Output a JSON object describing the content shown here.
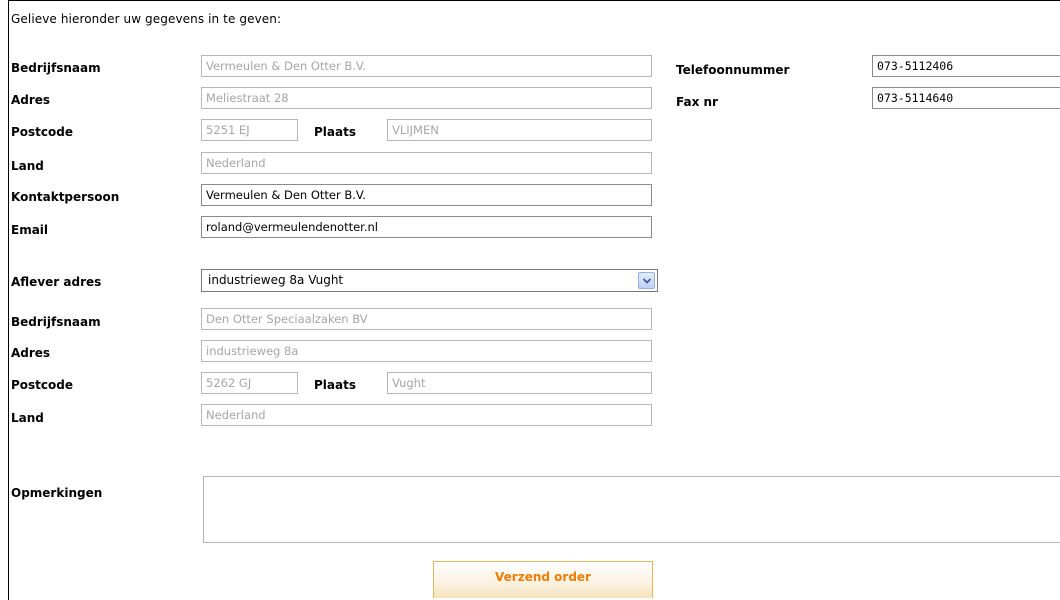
{
  "intro": "Gelieve hieronder uw gegevens in te geven:",
  "company": {
    "bedrijfsnaam_label": "Bedrijfsnaam",
    "bedrijfsnaam_value": "Vermeulen & Den Otter B.V.",
    "adres_label": "Adres",
    "adres_value": "Meliestraat 28",
    "postcode_label": "Postcode",
    "postcode_value": "5251 EJ",
    "plaats_label": "Plaats",
    "plaats_value": "VLIJMEN",
    "land_label": "Land",
    "land_value": "Nederland",
    "kontakt_label": "Kontaktpersoon",
    "kontakt_value": "Vermeulen & Den Otter B.V.",
    "email_label": "Email",
    "email_value": "roland@vermeulendenotter.nl",
    "telefoon_label": "Telefoonnummer",
    "telefoon_value": "073-5112406",
    "fax_label": "Fax nr",
    "fax_value": "073-5114640"
  },
  "delivery": {
    "aflever_label": "Aflever adres",
    "aflever_selected": "industrieweg 8a Vught",
    "bedrijfsnaam_label": "Bedrijfsnaam",
    "bedrijfsnaam_value": "Den Otter Speciaalzaken BV",
    "adres_label": "Adres",
    "adres_value": "industrieweg 8a",
    "postcode_label": "Postcode",
    "postcode_value": "5262 GJ",
    "plaats_label": "Plaats",
    "plaats_value": "Vught",
    "land_label": "Land",
    "land_value": "Nederland"
  },
  "opmerkingen": {
    "label": "Opmerkingen",
    "value": ""
  },
  "submit_label": "Verzend order",
  "icons": {
    "select_arrow": "chevron-down-icon"
  },
  "colors": {
    "button_text": "#f07c00",
    "button_border": "#e2b75a",
    "readonly_text": "#a6a6a6"
  }
}
